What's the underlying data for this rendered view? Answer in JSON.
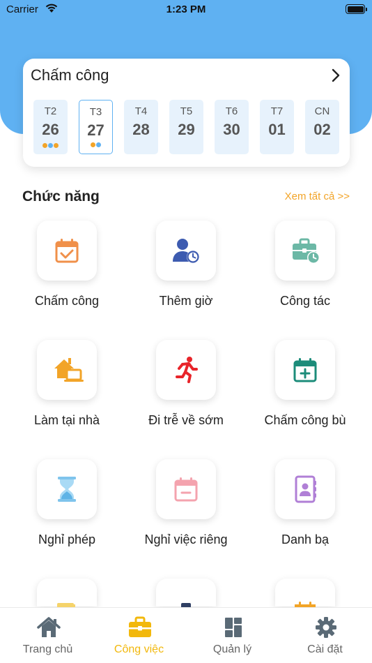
{
  "status": {
    "carrier": "Carrier",
    "time": "1:23 PM"
  },
  "attendance": {
    "title": "Chấm công",
    "days": [
      {
        "name": "T2",
        "date": "26"
      },
      {
        "name": "T3",
        "date": "27"
      },
      {
        "name": "T4",
        "date": "28"
      },
      {
        "name": "T5",
        "date": "29"
      },
      {
        "name": "T6",
        "date": "30"
      },
      {
        "name": "T7",
        "date": "01"
      },
      {
        "name": "CN",
        "date": "02"
      }
    ]
  },
  "functions": {
    "title": "Chức năng",
    "see_all": "Xem tất cả >>",
    "items": [
      {
        "label": "Chấm công",
        "icon": "calendar-check-icon"
      },
      {
        "label": "Thêm giờ",
        "icon": "user-clock-icon"
      },
      {
        "label": "Công tác",
        "icon": "briefcase-clock-icon"
      },
      {
        "label": "Làm tại nhà",
        "icon": "home-laptop-icon"
      },
      {
        "label": "Đi trễ về sớm",
        "icon": "running-man-icon"
      },
      {
        "label": "Chấm công bù",
        "icon": "calendar-plus-icon"
      },
      {
        "label": "Nghỉ phép",
        "icon": "hourglass-icon"
      },
      {
        "label": "Nghỉ việc riêng",
        "icon": "calendar-minus-icon"
      },
      {
        "label": "Danh bạ",
        "icon": "contacts-book-icon"
      }
    ]
  },
  "tabs": [
    {
      "label": "Trang chủ",
      "icon": "home-icon"
    },
    {
      "label": "Công việc",
      "icon": "briefcase-icon"
    },
    {
      "label": "Quản lý",
      "icon": "dashboard-icon"
    },
    {
      "label": "Cài đặt",
      "icon": "gear-icon"
    }
  ],
  "colors": {
    "header_blue": "#5fb1f2",
    "accent_orange": "#f2a428",
    "active_tab": "#f2b80c"
  }
}
